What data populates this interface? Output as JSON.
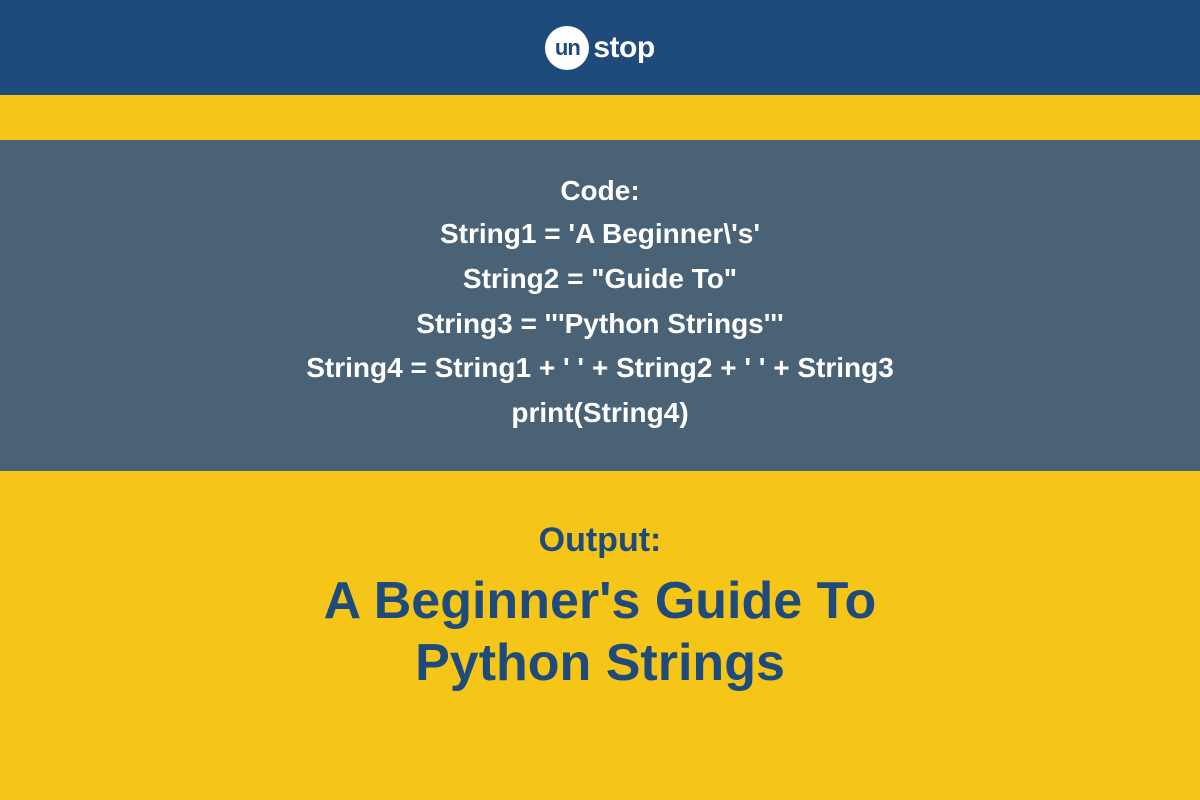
{
  "logo": {
    "circle_text": "un",
    "rest_text": "stop"
  },
  "code": {
    "label": "Code:",
    "lines": [
      "String1 = 'A Beginner\\'s'",
      "String2 = \"Guide To\"",
      "String3 = '''Python Strings'''",
      "String4 = String1 + ' ' + String2 + ' ' + String3",
      "print(String4)"
    ]
  },
  "output": {
    "label": "Output:",
    "line1": "A Beginner's Guide To",
    "line2": "Python Strings"
  },
  "colors": {
    "header_bg": "#1e4a7c",
    "code_bg": "#4a6275",
    "yellow": "#f5c518",
    "white": "#ffffff"
  }
}
